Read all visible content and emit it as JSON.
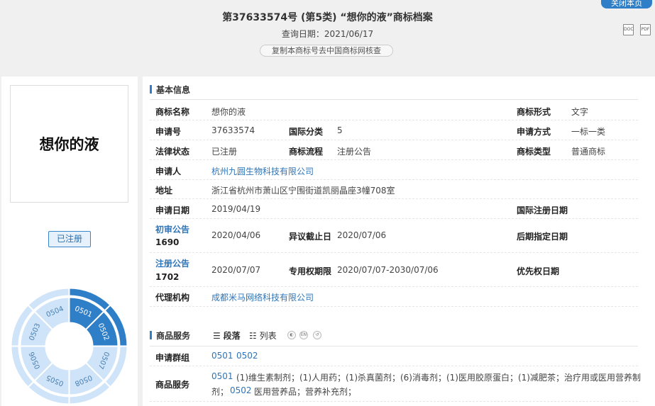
{
  "header": {
    "close_label": "关闭本页",
    "title": "第37633574号 (第5类) “想你的液”商标档案",
    "query_date_label": "查询日期：",
    "query_date": "2021/06/17",
    "copy_button": "复制本商标号去中国商标网核查",
    "doc_icon": "DOC",
    "pdf_icon": "PDF"
  },
  "left": {
    "mark_text": "想你的液",
    "status": "已注册",
    "wheel_segments": [
      "0501",
      "0502",
      "0507",
      "0508",
      "0505",
      "0506",
      "0503",
      "0504"
    ],
    "wheel_highlighted": [
      "0501",
      "0502"
    ],
    "colors": {
      "highlight": "#2f7fc8",
      "normal": "#cfe4f8",
      "text_normal": "#4a7fb0"
    }
  },
  "basic": {
    "section_title": "基本信息",
    "name_label": "商标名称",
    "name": "想你的液",
    "form_label": "商标形式",
    "form": "文字",
    "appno_label": "申请号",
    "appno": "37633574",
    "intl_class_label": "国际分类",
    "intl_class": "5",
    "method_label": "申请方式",
    "method": "一标一类",
    "legal_label": "法律状态",
    "legal": "已注册",
    "flow_label": "商标流程",
    "flow": "注册公告",
    "type_label": "商标类型",
    "type": "普通商标",
    "applicant_label": "申请人",
    "applicant": "杭州九圆生物科技有限公司",
    "address_label": "地址",
    "address": "浙江省杭州市萧山区宁围街道凯丽晶座3幢708室",
    "app_date_label": "申请日期",
    "app_date": "2019/04/19",
    "intl_reg_date_label": "国际注册日期",
    "prelim_label": "初审公告",
    "prelim_no": "1690",
    "prelim_date": "2020/04/06",
    "opp_deadline_label": "异议截止日",
    "opp_deadline": "2020/07/06",
    "later_date_label": "后期指定日期",
    "reg_notice_label": "注册公告",
    "reg_no": "1702",
    "reg_date": "2020/07/07",
    "exclusive_label": "专用权期限",
    "exclusive": "2020/07/07-2030/07/06",
    "priority_label": "优先权日期",
    "agent_label": "代理机构",
    "agent": "成都米马网络科技有限公司"
  },
  "goods": {
    "section_title": "商品服务",
    "view_para": "段落",
    "view_list": "列表",
    "icon_en": "EN",
    "group_label": "申请群组",
    "groups": [
      "0501",
      "0502"
    ],
    "services_label": "商品服务",
    "services_0501_code": "0501",
    "services_0501": "(1)维生素制剂；(1)人用药；(1)杀真菌剂；(6)消毒剂；(1)医用胶原蛋白；(1)减肥茶；治疗用或医用营养制",
    "services_0501_cont": "剂；",
    "services_0502_code": "0502",
    "services_0502": "医用营养品；营养补充剂；"
  }
}
